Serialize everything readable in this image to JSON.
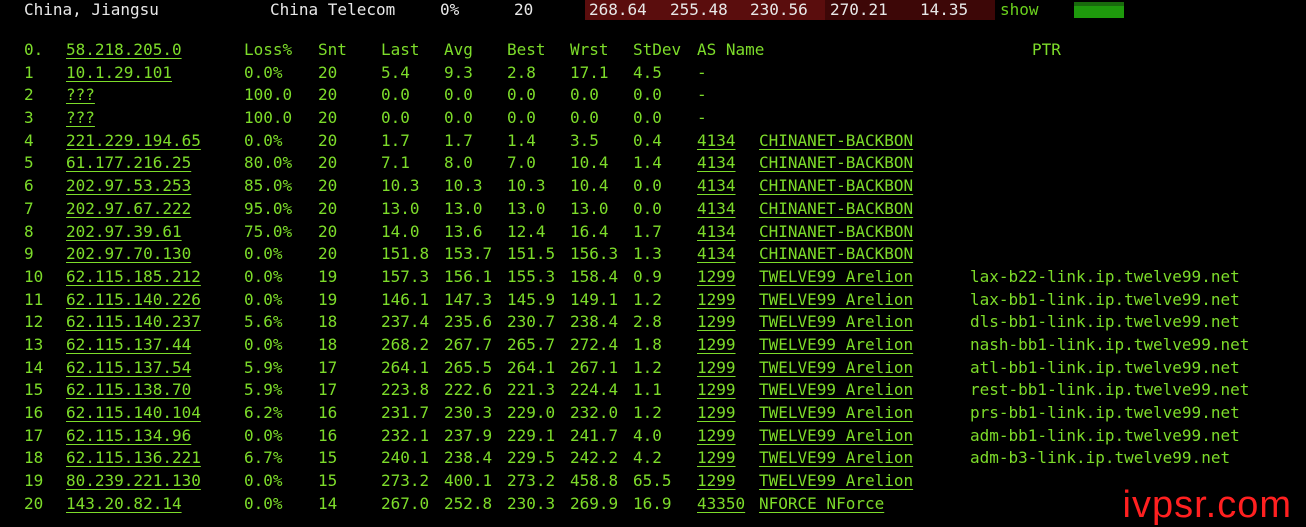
{
  "topbar": {
    "region": "China, Jiangsu",
    "isp": "China Telecom",
    "loss": "0%",
    "count": "20",
    "v1": "268.64",
    "v2": "255.48",
    "v3": "230.56",
    "v4": "270.21",
    "v5": "14.35",
    "show_label": "show"
  },
  "header": {
    "index": "0.",
    "host": "58.218.205.0",
    "loss": "Loss%",
    "snt": "Snt",
    "last": "Last",
    "avg": "Avg",
    "best": "Best",
    "wrst": "Wrst",
    "stdev": "StDev",
    "asname": "AS Name",
    "ptr": "PTR"
  },
  "hops": [
    {
      "i": "1",
      "host": "10.1.29.101",
      "loss": "0.0%",
      "snt": "20",
      "last": "5.4",
      "avg": "9.3",
      "best": "2.8",
      "wrst": "17.1",
      "stdev": "4.5",
      "asn": "-",
      "asname": "",
      "ptr": ""
    },
    {
      "i": "2",
      "host": "???",
      "loss": "100.0",
      "snt": "20",
      "last": "0.0",
      "avg": "0.0",
      "best": "0.0",
      "wrst": "0.0",
      "stdev": "0.0",
      "asn": "-",
      "asname": "",
      "ptr": ""
    },
    {
      "i": "3",
      "host": "???",
      "loss": "100.0",
      "snt": "20",
      "last": "0.0",
      "avg": "0.0",
      "best": "0.0",
      "wrst": "0.0",
      "stdev": "0.0",
      "asn": "-",
      "asname": "",
      "ptr": ""
    },
    {
      "i": "4",
      "host": "221.229.194.65",
      "loss": "0.0%",
      "snt": "20",
      "last": "1.7",
      "avg": "1.7",
      "best": "1.4",
      "wrst": "3.5",
      "stdev": "0.4",
      "asn": "4134",
      "asname": "CHINANET-BACKBON",
      "ptr": ""
    },
    {
      "i": "5",
      "host": "61.177.216.25",
      "loss": "80.0%",
      "snt": "20",
      "last": "7.1",
      "avg": "8.0",
      "best": "7.0",
      "wrst": "10.4",
      "stdev": "1.4",
      "asn": "4134",
      "asname": "CHINANET-BACKBON",
      "ptr": ""
    },
    {
      "i": "6",
      "host": "202.97.53.253",
      "loss": "85.0%",
      "snt": "20",
      "last": "10.3",
      "avg": "10.3",
      "best": "10.3",
      "wrst": "10.4",
      "stdev": "0.0",
      "asn": "4134",
      "asname": "CHINANET-BACKBON",
      "ptr": ""
    },
    {
      "i": "7",
      "host": "202.97.67.222",
      "loss": "95.0%",
      "snt": "20",
      "last": "13.0",
      "avg": "13.0",
      "best": "13.0",
      "wrst": "13.0",
      "stdev": "0.0",
      "asn": "4134",
      "asname": "CHINANET-BACKBON",
      "ptr": ""
    },
    {
      "i": "8",
      "host": "202.97.39.61",
      "loss": "75.0%",
      "snt": "20",
      "last": "14.0",
      "avg": "13.6",
      "best": "12.4",
      "wrst": "16.4",
      "stdev": "1.7",
      "asn": "4134",
      "asname": "CHINANET-BACKBON",
      "ptr": ""
    },
    {
      "i": "9",
      "host": "202.97.70.130",
      "loss": "0.0%",
      "snt": "20",
      "last": "151.8",
      "avg": "153.7",
      "best": "151.5",
      "wrst": "156.3",
      "stdev": "1.3",
      "asn": "4134",
      "asname": "CHINANET-BACKBON",
      "ptr": ""
    },
    {
      "i": "10",
      "host": "62.115.185.212",
      "loss": "0.0%",
      "snt": "19",
      "last": "157.3",
      "avg": "156.1",
      "best": "155.3",
      "wrst": "158.4",
      "stdev": "0.9",
      "asn": "1299",
      "asname": "TWELVE99 Arelion",
      "ptr": "lax-b22-link.ip.twelve99.net"
    },
    {
      "i": "11",
      "host": "62.115.140.226",
      "loss": "0.0%",
      "snt": "19",
      "last": "146.1",
      "avg": "147.3",
      "best": "145.9",
      "wrst": "149.1",
      "stdev": "1.2",
      "asn": "1299",
      "asname": "TWELVE99 Arelion",
      "ptr": "lax-bb1-link.ip.twelve99.net"
    },
    {
      "i": "12",
      "host": "62.115.140.237",
      "loss": "5.6%",
      "snt": "18",
      "last": "237.4",
      "avg": "235.6",
      "best": "230.7",
      "wrst": "238.4",
      "stdev": "2.8",
      "asn": "1299",
      "asname": "TWELVE99 Arelion",
      "ptr": "dls-bb1-link.ip.twelve99.net"
    },
    {
      "i": "13",
      "host": "62.115.137.44",
      "loss": "0.0%",
      "snt": "18",
      "last": "268.2",
      "avg": "267.7",
      "best": "265.7",
      "wrst": "272.4",
      "stdev": "1.8",
      "asn": "1299",
      "asname": "TWELVE99 Arelion",
      "ptr": "nash-bb1-link.ip.twelve99.net"
    },
    {
      "i": "14",
      "host": "62.115.137.54",
      "loss": "5.9%",
      "snt": "17",
      "last": "264.1",
      "avg": "265.5",
      "best": "264.1",
      "wrst": "267.1",
      "stdev": "1.2",
      "asn": "1299",
      "asname": "TWELVE99 Arelion",
      "ptr": "atl-bb1-link.ip.twelve99.net"
    },
    {
      "i": "15",
      "host": "62.115.138.70",
      "loss": "5.9%",
      "snt": "17",
      "last": "223.8",
      "avg": "222.6",
      "best": "221.3",
      "wrst": "224.4",
      "stdev": "1.1",
      "asn": "1299",
      "asname": "TWELVE99 Arelion",
      "ptr": "rest-bb1-link.ip.twelve99.net"
    },
    {
      "i": "16",
      "host": "62.115.140.104",
      "loss": "6.2%",
      "snt": "16",
      "last": "231.7",
      "avg": "230.3",
      "best": "229.0",
      "wrst": "232.0",
      "stdev": "1.2",
      "asn": "1299",
      "asname": "TWELVE99 Arelion",
      "ptr": "prs-bb1-link.ip.twelve99.net"
    },
    {
      "i": "17",
      "host": "62.115.134.96",
      "loss": "0.0%",
      "snt": "16",
      "last": "232.1",
      "avg": "237.9",
      "best": "229.1",
      "wrst": "241.7",
      "stdev": "4.0",
      "asn": "1299",
      "asname": "TWELVE99 Arelion",
      "ptr": "adm-bb1-link.ip.twelve99.net"
    },
    {
      "i": "18",
      "host": "62.115.136.221",
      "loss": "6.7%",
      "snt": "15",
      "last": "240.1",
      "avg": "238.4",
      "best": "229.5",
      "wrst": "242.2",
      "stdev": "4.2",
      "asn": "1299",
      "asname": "TWELVE99 Arelion",
      "ptr": "adm-b3-link.ip.twelve99.net"
    },
    {
      "i": "19",
      "host": "80.239.221.130",
      "loss": "0.0%",
      "snt": "15",
      "last": "273.2",
      "avg": "400.1",
      "best": "273.2",
      "wrst": "458.8",
      "stdev": "65.5",
      "asn": "1299",
      "asname": "TWELVE99 Arelion",
      "ptr": ""
    },
    {
      "i": "20",
      "host": "143.20.82.14",
      "loss": "0.0%",
      "snt": "14",
      "last": "267.0",
      "avg": "252.8",
      "best": "230.3",
      "wrst": "269.9",
      "stdev": "16.9",
      "asn": "43350",
      "asname": "NFORCE NForce",
      "ptr": ""
    }
  ],
  "watermark": {
    "text": "ivpsr.com",
    "color": "#ff2020"
  },
  "colors": {
    "text": "#7ddc2a",
    "background": "#000000",
    "topbar_text": "#e8e8e8",
    "bar": "#1e9a0c"
  }
}
